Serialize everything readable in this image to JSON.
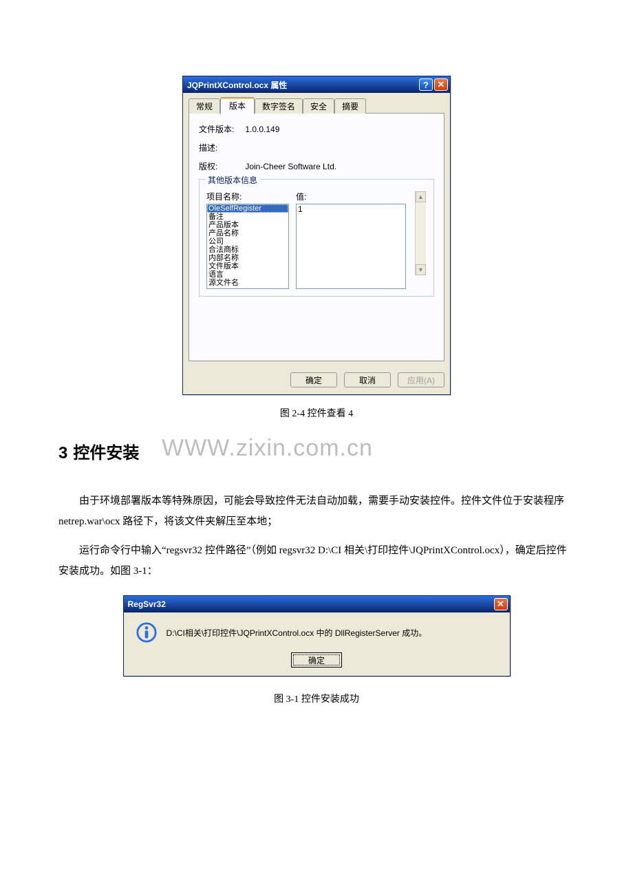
{
  "propsDialog": {
    "title": "JQPrintXControl.ocx 属性",
    "tabs": [
      "常规",
      "版本",
      "数字签名",
      "安全",
      "摘要"
    ],
    "activeTab": "版本",
    "fileVersion": {
      "label": "文件版本:",
      "value": "1.0.0.149"
    },
    "description": {
      "label": "描述:",
      "value": ""
    },
    "copyright": {
      "label": "版权:",
      "value": "Join-Cheer Software Ltd."
    },
    "otherGroup": {
      "legend": "其他版本信息",
      "nameHeader": "项目名称:",
      "valueHeader": "值:",
      "items": [
        "OleSelfRegister",
        "备注",
        "产品版本",
        "产品名称",
        "公司",
        "合法商标",
        "内部名称",
        "文件版本",
        "语言",
        "源文件名"
      ],
      "selected": "OleSelfRegister",
      "value": "1"
    },
    "buttons": {
      "ok": "确定",
      "cancel": "取消",
      "apply": "应用(A)"
    }
  },
  "caption1": "图 2-4 控件查看 4",
  "heading": {
    "num": "3",
    "text": "控件安装"
  },
  "watermark": "WWW.zixin.com.cn",
  "para1": "由于环境部署版本等特殊原因，可能会导致控件无法自动加载，需要手动安装控件。控件文件位于安装程序 netrep.war\\ocx 路径下，将该文件夹解压至本地；",
  "para2": "运行命令行中输入“regsvr32 控件路径”（例如 regsvr32 D:\\CI 相关\\打印控件\\JQPrintXControl.ocx），确定后控件安装成功。如图 3-1：",
  "regDialog": {
    "title": "RegSvr32",
    "message": "D:\\CI相关\\打印控件\\JQPrintXControl.ocx 中的 DllRegisterServer 成功。",
    "ok": "确定"
  },
  "caption2": "图 3-1 控件安装成功"
}
